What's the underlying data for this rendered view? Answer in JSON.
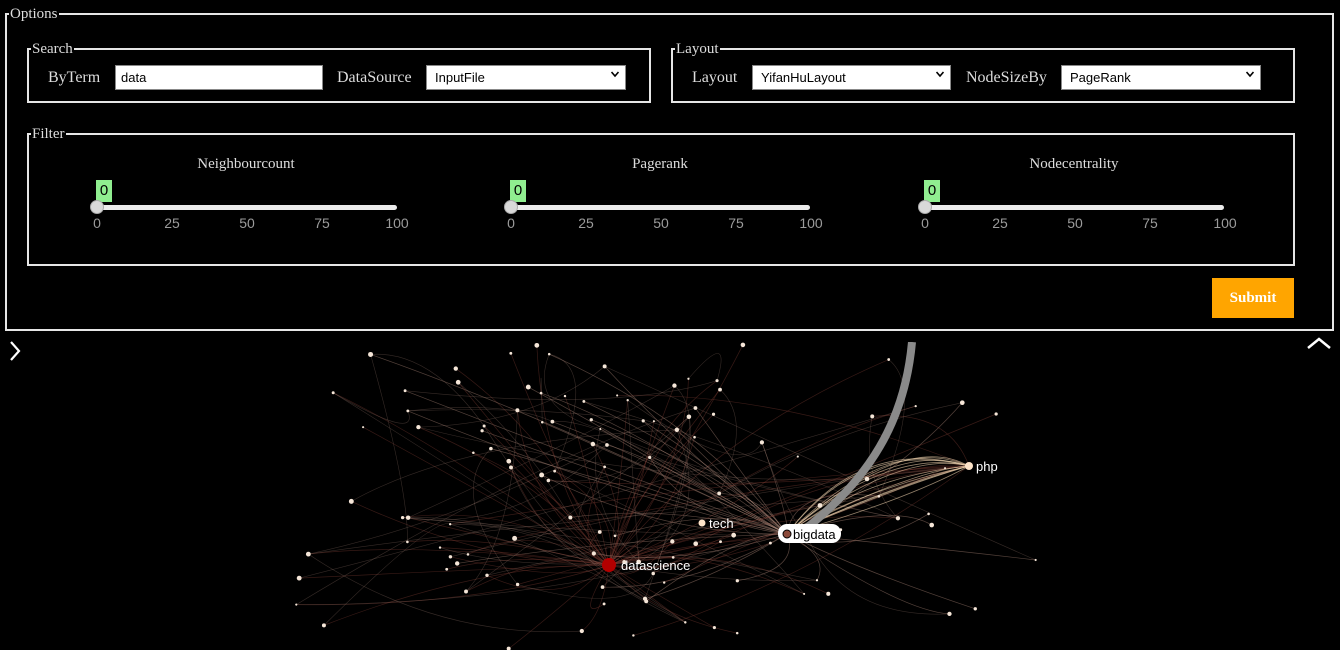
{
  "options": {
    "legend": "Options",
    "search": {
      "legend": "Search",
      "byterm_label": "ByTerm",
      "byterm_value": "data",
      "datasource_label": "DataSource",
      "datasource_value": "InputFile"
    },
    "layout": {
      "legend": "Layout",
      "layout_label": "Layout",
      "layout_value": "YifanHuLayout",
      "nodesize_label": "NodeSizeBy",
      "nodesize_value": "PageRank"
    },
    "filter": {
      "legend": "Filter",
      "sliders": [
        {
          "title": "Neighbourcount",
          "value": "0",
          "ticks": [
            "0",
            "25",
            "50",
            "75",
            "100"
          ]
        },
        {
          "title": "Pagerank",
          "value": "0",
          "ticks": [
            "0",
            "25",
            "50",
            "75",
            "100"
          ]
        },
        {
          "title": "Nodecentrality",
          "value": "0",
          "ticks": [
            "0",
            "25",
            "50",
            "75",
            "100"
          ]
        }
      ]
    },
    "submit_label": "Submit"
  },
  "graph": {
    "labels": {
      "php": "php",
      "tech": "tech",
      "bigdata": "bigdata",
      "datascience": "datascience"
    }
  },
  "colors": {
    "accent": "#ffa500",
    "slider_badge": "#90ee90",
    "datascience_node": "#b30000"
  },
  "icons": {
    "left_toggle": "chevron-right-icon",
    "right_toggle": "chevron-up-icon"
  }
}
